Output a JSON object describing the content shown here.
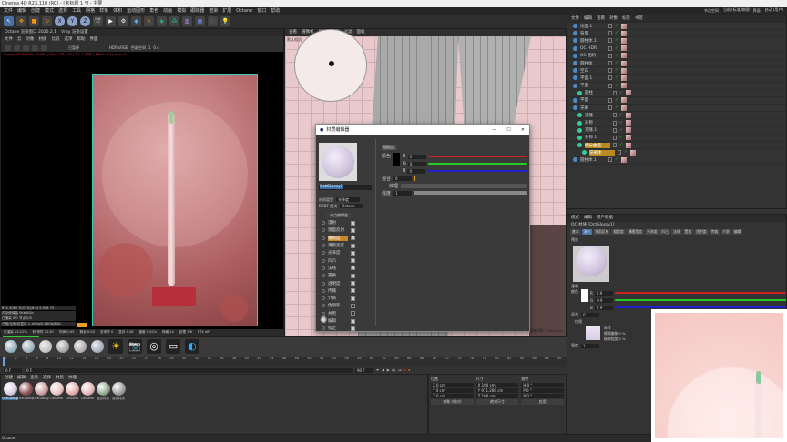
{
  "window": {
    "title": "Cinema 4D R23.110 (RC) - [未标题 1 *] - 主要"
  },
  "menu": [
    "文件",
    "编辑",
    "创建",
    "模式",
    "选择",
    "工具",
    "网格",
    "样条",
    "体积",
    "运动图形",
    "角色",
    "动画",
    "模拟",
    "跟踪器",
    "渲染",
    "扩展",
    "Octane",
    "窗口",
    "帮助"
  ],
  "toolbar": {
    "x": "X",
    "y": "Y",
    "z": "Z"
  },
  "layout": {
    "label": "界面",
    "value": "启动 (用户)",
    "node_label": "节点空间",
    "node_value": "当前 (标准/物理)"
  },
  "octane_viewer": {
    "title": "Octane 渲染窗口 2020.2.1",
    "tab2": "Vray 渲染设置",
    "menu": [
      "文件",
      "云",
      "对象",
      "材质",
      "比较",
      "选项",
      "帮助",
      "界面"
    ],
    "status_label": "已暂停",
    "hdr": "HDR sRGB",
    "gamma_label": "色彩空间",
    "value1": "1",
    "value2": "0.4",
    "info": "Cinema4D Render 20480 | Spp:128/128 | Tri: 1.46M | Mesh: 74 | Hair: 0",
    "stats": [
      "RTX 3060 Ti(GTX)[8.6]    9,508    75",
      "内存使用量 0Kb/8Gb",
      "已渲染 0/0  节点 0/0",
      "已用/空闲/总显存 1.16Gb/5.26Gb/8Gb"
    ],
    "statusline": [
      "已渲染 13.21%",
      "秒/采样 12.87",
      "时间 0:45",
      "剩余 0:00",
      "总采样 0",
      "显存 5.26",
      "速度 0.67/s",
      "网格 14",
      "纹理 1/6",
      "RTX off"
    ]
  },
  "viewport": {
    "menu": [
      "查看",
      "摄像机",
      "显示",
      "选项",
      "过滤",
      "面板"
    ],
    "camera": "默认相机",
    "grid": "网格间距：1000 cm"
  },
  "material_editor": {
    "title": "材质编辑器",
    "name": "OctGlossy1",
    "mat_type_label": "材质类型",
    "mat_type": "光泽度",
    "brdf_label": "BRDF 模式",
    "brdf": "Octane",
    "node_btn": "节点编辑器",
    "channels": [
      {
        "label": "漫射",
        "on": true
      },
      {
        "label": "镜面反射",
        "on": true
      },
      {
        "label": "粗糙度",
        "on": true
      },
      {
        "label": "薄膜宽度",
        "on": true
      },
      {
        "label": "光泽度",
        "on": true
      },
      {
        "label": "凹凸",
        "on": true
      },
      {
        "label": "法线",
        "on": true
      },
      {
        "label": "置换",
        "on": true
      },
      {
        "label": "透明度",
        "on": true
      },
      {
        "label": "传输",
        "on": true
      },
      {
        "label": "介质",
        "on": true
      },
      {
        "label": "伪阴影",
        "on": false
      },
      {
        "label": "共用",
        "on": false
      },
      {
        "label": "编辑",
        "on": true
      },
      {
        "label": "指定",
        "on": true
      }
    ],
    "section": "粗糙度",
    "color_label": "颜色",
    "r": "0",
    "g": "0",
    "b": "0",
    "mix_label": "混合",
    "mix": "0",
    "texture_label": "纹理",
    "power_label": "强度",
    "power": "1"
  },
  "objects": {
    "menu": [
      "文件",
      "编辑",
      "查看",
      "对象",
      "标签",
      "书签"
    ],
    "items": [
      {
        "name": "地面.1",
        "indent": 0
      },
      {
        "name": "背景",
        "indent": 0
      },
      {
        "name": "圆柱体.1",
        "indent": 0
      },
      {
        "name": "OC HDR",
        "indent": 0
      },
      {
        "name": "OC 相机",
        "indent": 0
      },
      {
        "name": "圆柱体",
        "indent": 0
      },
      {
        "name": "空白",
        "indent": 0
      },
      {
        "name": "平面.1",
        "indent": 0
      },
      {
        "name": "平面",
        "indent": 0
      },
      {
        "name": "圆柱",
        "indent": 1
      },
      {
        "name": "平面",
        "indent": 0
      },
      {
        "name": "牙刷",
        "indent": 0
      },
      {
        "name": "克隆",
        "indent": 1
      },
      {
        "name": "对称",
        "indent": 1
      },
      {
        "name": "克隆.1",
        "indent": 1
      },
      {
        "name": "对称.1",
        "indent": 1
      },
      {
        "name": "细分曲面",
        "indent": 1
      },
      {
        "name": "牙刷体",
        "indent": 2
      },
      {
        "name": "圆柱体.1",
        "indent": 0
      }
    ]
  },
  "attributes": {
    "menu": [
      "模式",
      "编辑",
      "用户数据"
    ],
    "title": "OC 材质 [OctGlossy1]",
    "tabs": [
      "基本",
      "漫射",
      "镜面反射",
      "粗糙度",
      "薄膜宽度",
      "光泽度",
      "凹凸",
      "法线",
      "置换",
      "透明度",
      "传输",
      "介质",
      "编辑"
    ],
    "preview_label": "预览",
    "section": "漫射",
    "color_label": "颜色",
    "r": "0.9",
    "g": "0.9",
    "b": "0.9",
    "mix_label": "混合",
    "mix": "0",
    "texture_label": "纹理",
    "sample_label": "采样",
    "blur_offset_label": "模糊偏移",
    "blur_offset": "0 %",
    "blur_label": "模糊程度",
    "blur": "0 %",
    "power_label": "强度",
    "power": "1"
  },
  "timeline": {
    "ticks": [
      "0",
      "2",
      "4",
      "6",
      "8",
      "10",
      "12",
      "14",
      "16",
      "18",
      "20",
      "22",
      "24",
      "26",
      "28",
      "30",
      "32",
      "34",
      "36",
      "38",
      "40",
      "42",
      "44",
      "46",
      "48",
      "50",
      "52",
      "54",
      "56",
      "58",
      "60",
      "62",
      "64",
      "66",
      "68",
      "70",
      "72",
      "74",
      "76",
      "78",
      "80",
      "82",
      "84",
      "86",
      "88",
      "90"
    ],
    "start": "0 F",
    "end": "90 F",
    "current": "0 F"
  },
  "materials": {
    "menu": [
      "创建",
      "编辑",
      "查看",
      "选择",
      "材质",
      "纹理"
    ],
    "items": [
      {
        "name": "OctGlossy",
        "c": "#d8cce6"
      },
      {
        "name": "OctGlossy",
        "c": "#8a4a4e"
      },
      {
        "name": "OctGlossy",
        "c": "#c79a9a"
      },
      {
        "name": "OctDiffu",
        "c": "#e8c3c0"
      },
      {
        "name": "OctDiffu",
        "c": "#e2aaa8"
      },
      {
        "name": "OctDiffu",
        "c": "#e6b5b8"
      },
      {
        "name": "混合材质",
        "c": "#8fa88a"
      },
      {
        "name": "混合材质",
        "c": "#9a9a9a"
      }
    ]
  },
  "coords": {
    "pos_label": "位置",
    "size_label": "尺寸",
    "rot_label": "旋转",
    "px": "0 cm",
    "py": "0 cm",
    "pz": "0 cm",
    "sx": "100 cm",
    "sy": "971.289 cm",
    "sz": "100 cm",
    "h": "0 °",
    "p": "0 °",
    "b": "0 °",
    "mode": "对象 (相对)",
    "size_mode": "绝对尺寸",
    "apply": "应用"
  },
  "statusbar": "Octane:"
}
